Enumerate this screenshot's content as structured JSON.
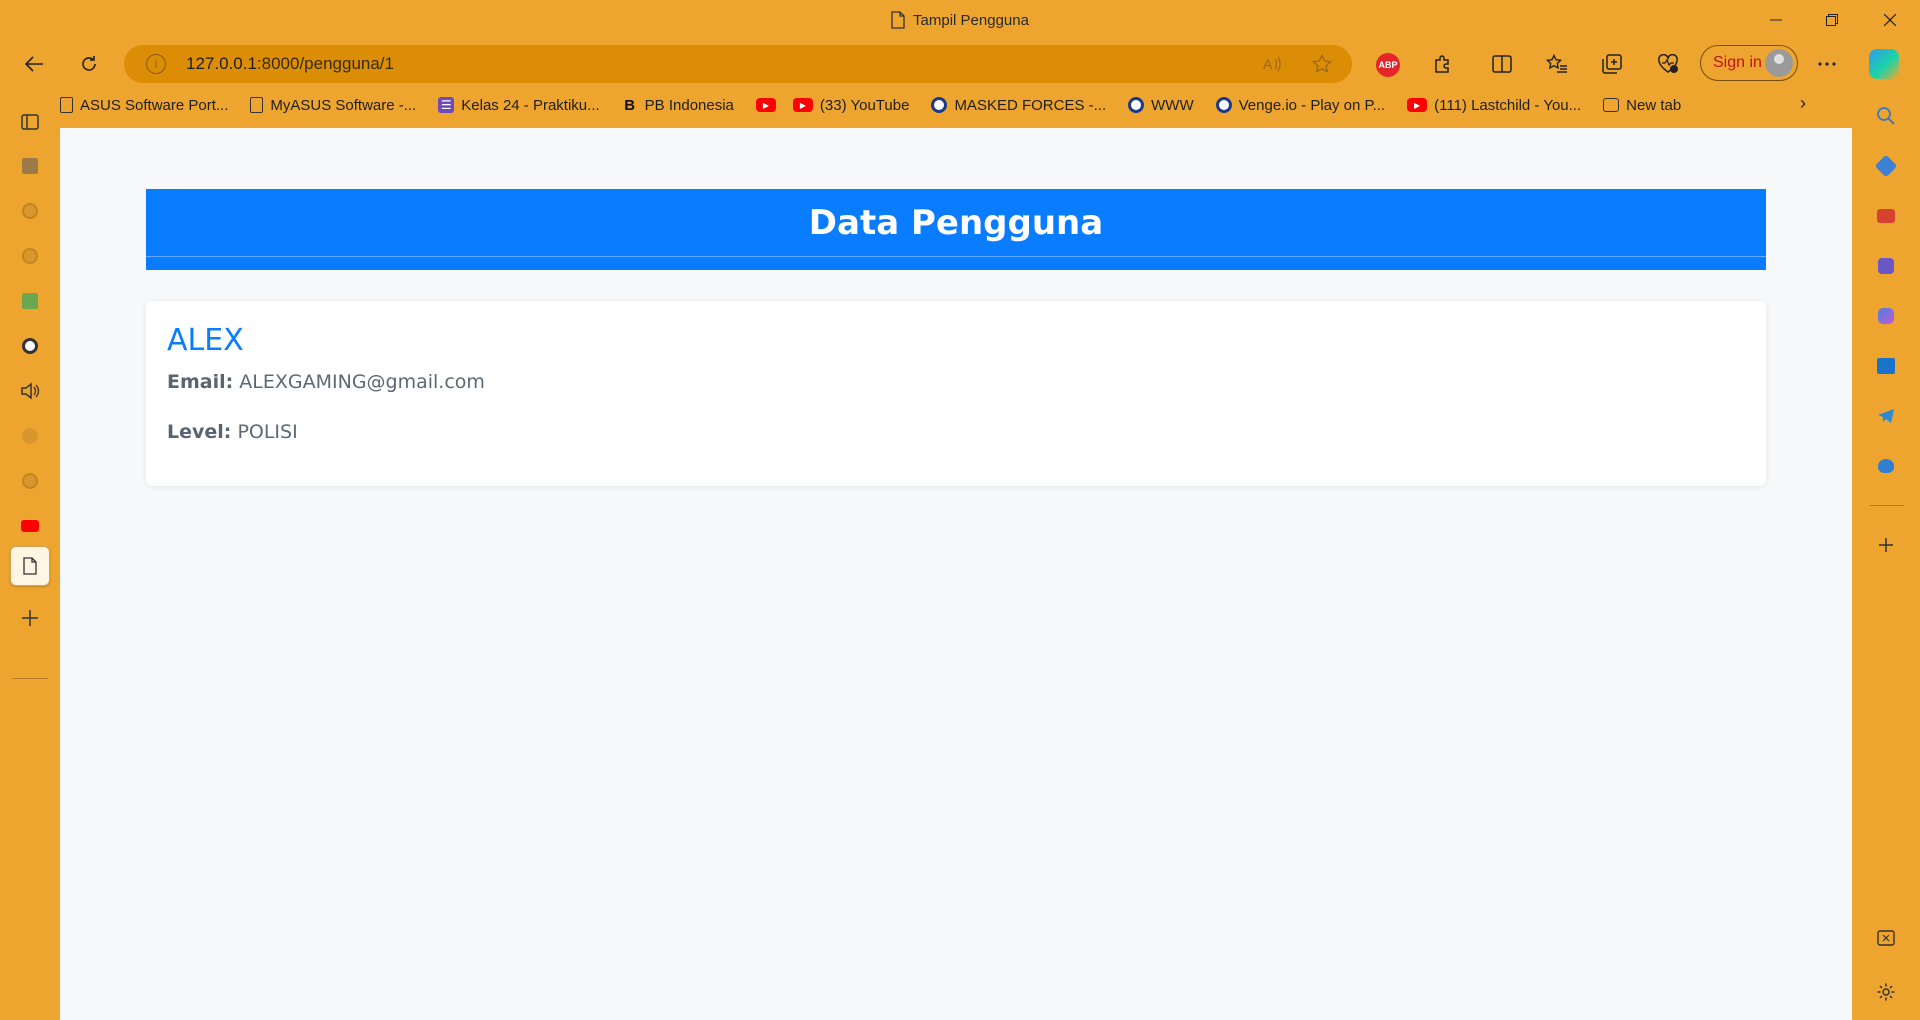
{
  "window": {
    "title": "Tampil Pengguna",
    "minimize_icon": "minimize-icon",
    "maximize_icon": "restore-icon",
    "close_icon": "close-icon"
  },
  "toolbar": {
    "url_host": "127.0.0.1",
    "url_path": ":8000/pengguna/1",
    "signin_label": "Sign in",
    "abp_label": "ABP"
  },
  "bookmarks": [
    {
      "label": "ASUS Software Port...",
      "icon": "document-icon"
    },
    {
      "label": "MyASUS Software -...",
      "icon": "document-icon"
    },
    {
      "label": "Kelas 24 - Praktiku...",
      "icon": "form-icon"
    },
    {
      "label": "PB Indonesia",
      "icon": "pb-icon"
    },
    {
      "label": "",
      "icon": "youtube-icon"
    },
    {
      "label": "(33) YouTube",
      "icon": "youtube-icon"
    },
    {
      "label": "MASKED FORCES -...",
      "icon": "globe-icon"
    },
    {
      "label": "WWW",
      "icon": "globe-icon"
    },
    {
      "label": "Venge.io - Play on P...",
      "icon": "globe-icon"
    },
    {
      "label": "(111) Lastchild - You...",
      "icon": "youtube-icon"
    },
    {
      "label": "New tab",
      "icon": "tab-icon"
    }
  ],
  "page": {
    "heading": "Data Pengguna",
    "user_name": "ALEX",
    "email_label": "Email:",
    "email_value": "ALEXGAMING@gmail.com",
    "level_label": "Level:",
    "level_value": "POLISI"
  },
  "colors": {
    "browser_frame": "#eea52f",
    "address_bar": "#dc8d06",
    "header_band": "#0a7cff",
    "name_link": "#0a7cff",
    "page_background": "#f7f8fa"
  }
}
